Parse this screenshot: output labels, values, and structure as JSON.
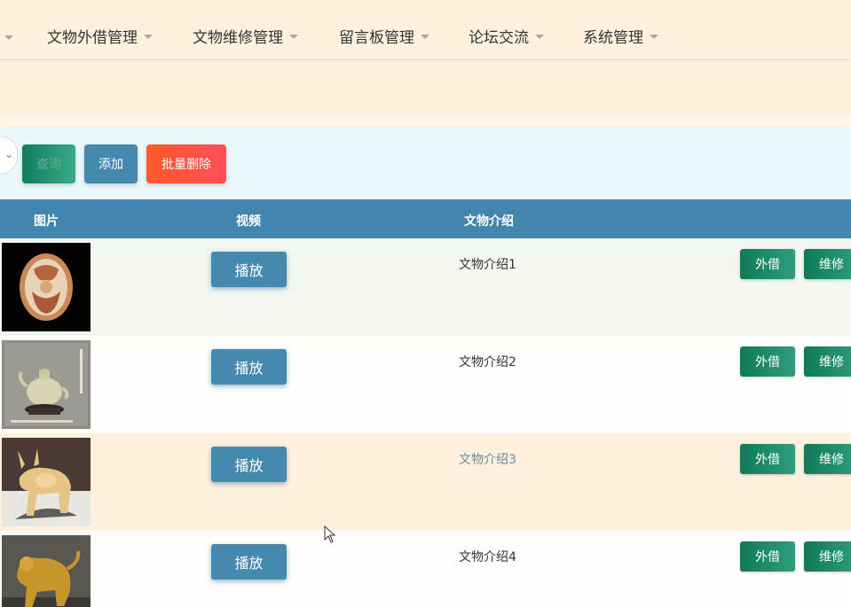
{
  "nav": {
    "items": [
      {
        "label": "文物外借管理"
      },
      {
        "label": "文物维修管理"
      },
      {
        "label": "留言板管理"
      },
      {
        "label": "论坛交流"
      },
      {
        "label": "系统管理"
      }
    ]
  },
  "toolbar": {
    "search_label": "查询",
    "add_label": "添加",
    "batch_delete_label": "批量删除"
  },
  "table": {
    "headers": {
      "image": "图片",
      "video": "视频",
      "intro": "文物介绍"
    },
    "rows": [
      {
        "play_label": "播放",
        "intro": "文物介绍1",
        "lend_label": "外借",
        "repair_label": "维修",
        "bg": "#f3f7f0",
        "intro_color": "#333333"
      },
      {
        "play_label": "播放",
        "intro": "文物介绍2",
        "lend_label": "外借",
        "repair_label": "维修",
        "bg": "#fffefb",
        "intro_color": "#333333"
      },
      {
        "play_label": "播放",
        "intro": "文物介绍3",
        "lend_label": "外借",
        "repair_label": "维修",
        "bg": "#fff1de",
        "intro_color": "#6a8aa5"
      },
      {
        "play_label": "播放",
        "intro": "文物介绍4",
        "lend_label": "外借",
        "repair_label": "维修",
        "bg": "#fffefb",
        "intro_color": "#333333"
      }
    ]
  },
  "colors": {
    "primary": "#4386ad",
    "success": "#0e7a57",
    "danger": "#ff5040",
    "page_bg": "#fff1de"
  }
}
